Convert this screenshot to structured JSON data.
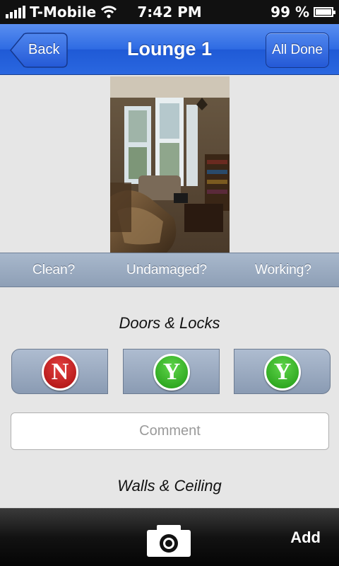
{
  "status_bar": {
    "carrier": "T-Mobile",
    "time": "7:42 PM",
    "battery": "99 %"
  },
  "nav": {
    "back_label": "Back",
    "title": "Lounge 1",
    "done_label": "All Done"
  },
  "photo": {
    "subject": "Room photo of lounge"
  },
  "columns": [
    "Clean?",
    "Undamaged?",
    "Working?"
  ],
  "sections": [
    {
      "title": "Doors & Locks",
      "answers": [
        "N",
        "Y",
        "Y"
      ]
    },
    {
      "title": "Walls & Ceiling"
    }
  ],
  "comment": {
    "placeholder": "Comment"
  },
  "toolbar": {
    "camera_icon": "camera-icon",
    "add_label": "Add"
  },
  "colors": {
    "nav_blue": "#2e6be3",
    "no_red": "#c41d1d",
    "yes_green": "#2fa51f"
  }
}
